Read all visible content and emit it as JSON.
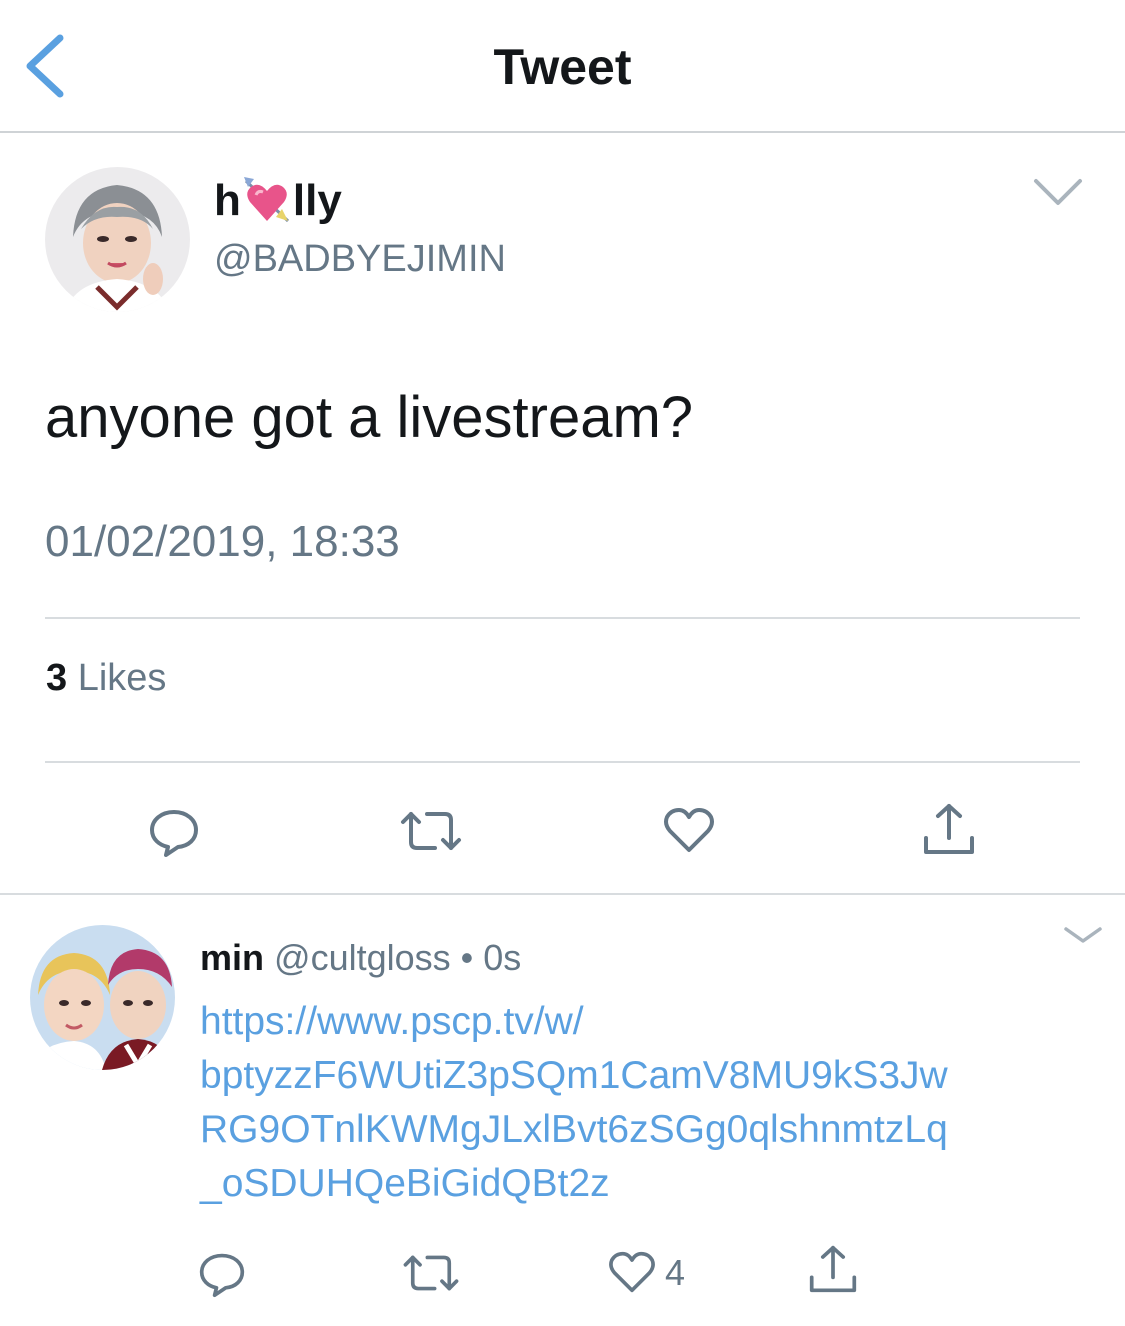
{
  "nav": {
    "title": "Tweet"
  },
  "tweet": {
    "name_before": "h",
    "name_after": "lly",
    "handle": "@BADBYEJIMIN",
    "text": "anyone got a livestream?",
    "timestamp": "01/02/2019, 18:33",
    "likes_count": "3",
    "likes_label": "Likes"
  },
  "reply": {
    "name": "min",
    "handle": "@cultgloss",
    "separator": "•",
    "time": "0s",
    "link_lines": [
      "https://www.pscp.tv/w/",
      "bptyzzF6WUtiZ3pSQm1CamV8MU9kS3Jw",
      "RG9OTnlKWMgJLxlBvt6zSGg0qlshnmtzLq",
      "_oSDUHQeBiGidQBt2z"
    ],
    "like_count": "4"
  },
  "colors": {
    "accent": "#5aa0e0",
    "text": "#14171a",
    "secondary": "#657786",
    "divider": "#d8dcdf",
    "icon": "#657786"
  },
  "icons": [
    "back-chevron-icon",
    "sparkling-heart-arrow-emoji",
    "caret-down-icon",
    "reply-icon",
    "retweet-icon",
    "like-heart-icon",
    "share-icon"
  ]
}
